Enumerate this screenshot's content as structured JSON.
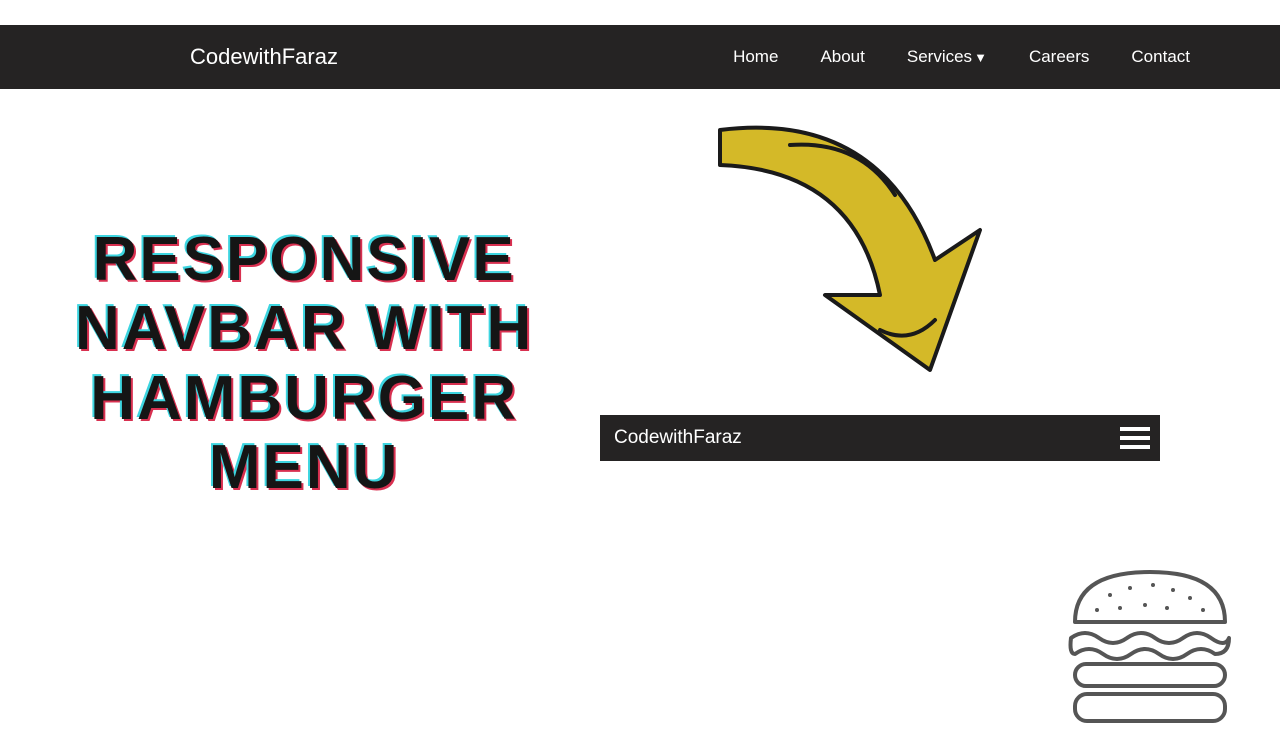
{
  "navbar": {
    "brand": "CodewithFaraz",
    "links": [
      {
        "label": "Home"
      },
      {
        "label": "About"
      },
      {
        "label": "Services",
        "hasDropdown": true
      },
      {
        "label": "Careers"
      },
      {
        "label": "Contact"
      }
    ]
  },
  "hero": {
    "line1": "RESPONSIVE",
    "line2": "NAVBAR WITH",
    "line3": "HAMBURGER",
    "line4": "MENU"
  },
  "mobileNav": {
    "brand": "CodewithFaraz"
  },
  "colors": {
    "navbarBg": "#252323",
    "arrowFill": "#d4b928",
    "heroBlack": "#151515",
    "heroCyan": "#3dd5e0",
    "heroPink": "#d83050"
  }
}
